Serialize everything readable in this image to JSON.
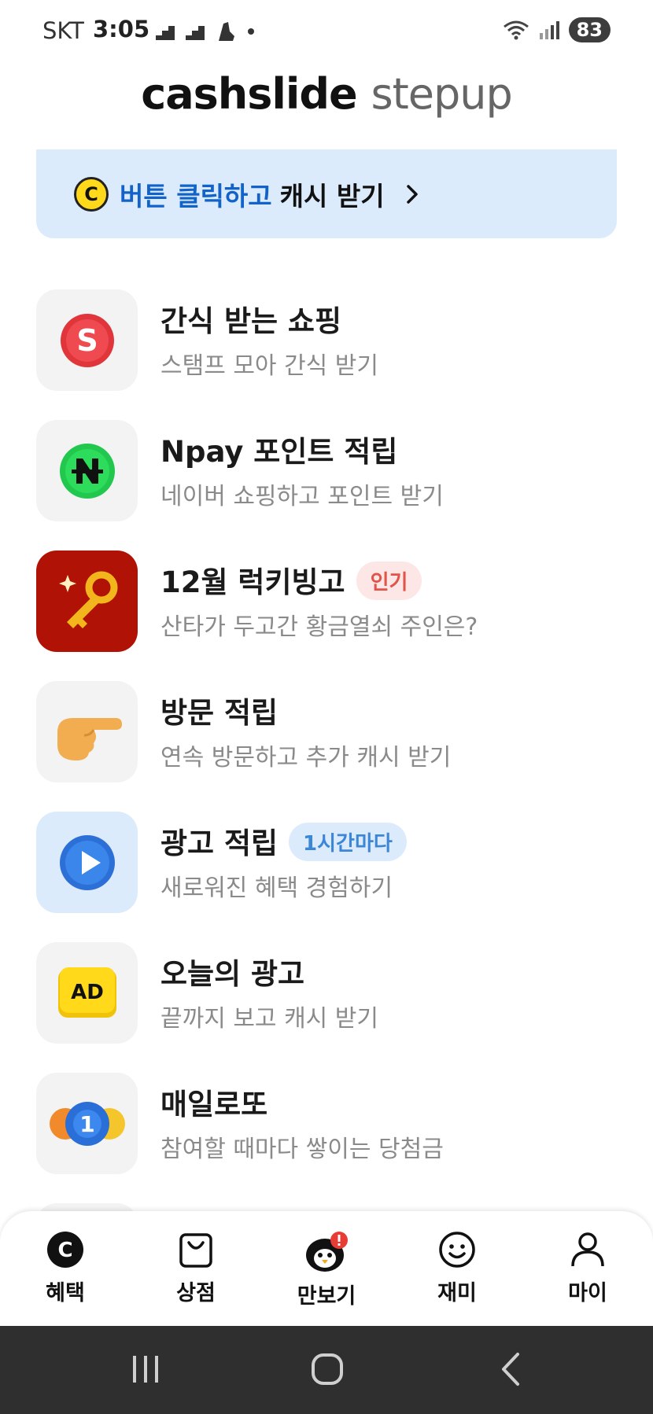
{
  "status": {
    "carrier": "SKT",
    "time": "3:05",
    "battery": "83"
  },
  "brand": {
    "part1": "cashslide",
    "part2": "stepup"
  },
  "banner": {
    "coin_letter": "C",
    "highlight": "버튼 클릭하고",
    "text": "캐시 받기"
  },
  "items": [
    {
      "title": "간식 받는 쇼핑",
      "subtitle": "스탬프 모아 간식 받기",
      "icon": "s-coin-icon"
    },
    {
      "title": "Npay 포인트 적립",
      "subtitle": "네이버 쇼핑하고 포인트 받기",
      "icon": "npay-icon"
    },
    {
      "title": "12월 럭키빙고",
      "badge": "인기",
      "subtitle": "산타가 두고간 황금열쇠 주인은?",
      "icon": "golden-key-icon"
    },
    {
      "title": "방문 적립",
      "subtitle": "연속 방문하고 추가 캐시 받기",
      "icon": "pointing-hand-icon"
    },
    {
      "title": "광고 적립",
      "badge": "1시간마다",
      "subtitle": "새로워진 혜택 경험하기",
      "icon": "play-button-icon"
    },
    {
      "title": "오늘의 광고",
      "subtitle": "끝까지 보고 캐시 받기",
      "icon": "ad-icon"
    },
    {
      "title": "매일로또",
      "subtitle": "참여할 때마다 쌓이는 당첨금",
      "icon": "lotto-ball-icon"
    }
  ],
  "tabs": [
    {
      "label": "혜택",
      "icon": "cash-coin-icon",
      "active": true
    },
    {
      "label": "상점",
      "icon": "shopping-bag-icon"
    },
    {
      "label": "만보기",
      "icon": "penguin-icon"
    },
    {
      "label": "재미",
      "icon": "smile-icon"
    },
    {
      "label": "마이",
      "icon": "person-icon"
    }
  ],
  "colors": {
    "accent": "#1163c9",
    "banner_bg": "#dcebfb",
    "hot_badge": "#e2544a",
    "info_badge": "#3c86d8"
  }
}
